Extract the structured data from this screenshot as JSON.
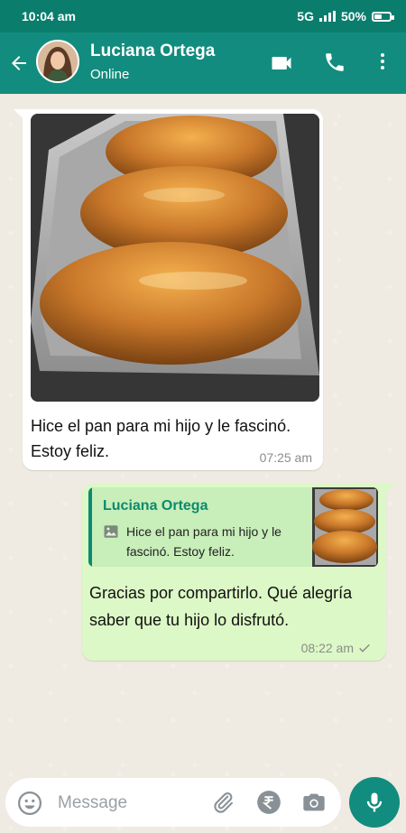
{
  "status_bar": {
    "time": "10:04 am",
    "network": "5G",
    "battery": "50%",
    "battery_level": 0.5
  },
  "header": {
    "contact_name": "Luciana Ortega",
    "contact_status": "Online"
  },
  "messages": {
    "incoming": {
      "text": " Hice el pan para mi hijo y le fascinó. Estoy feliz.",
      "time": "07:25 am"
    },
    "outgoing": {
      "quote_author": "Luciana Ortega",
      "quote_text": "Hice el pan para mi hijo y le fascinó. Estoy feliz.",
      "text": " Gracias por compartirlo. Qué alegría saber que tu hijo lo disfrutó.",
      "time": "08:22 am"
    }
  },
  "composer": {
    "placeholder": "Message"
  },
  "colors": {
    "header": "#128c7e",
    "status_bar": "#0b7d6d",
    "outgoing_bubble": "#dcf8c6",
    "accent_green": "#0b8a6f"
  },
  "icons": [
    "back-arrow-icon",
    "video-call-icon",
    "phone-icon",
    "more-vert-icon",
    "emoji-icon",
    "attach-icon",
    "rupee-icon",
    "camera-icon",
    "mic-icon",
    "image-icon",
    "check-icon"
  ]
}
